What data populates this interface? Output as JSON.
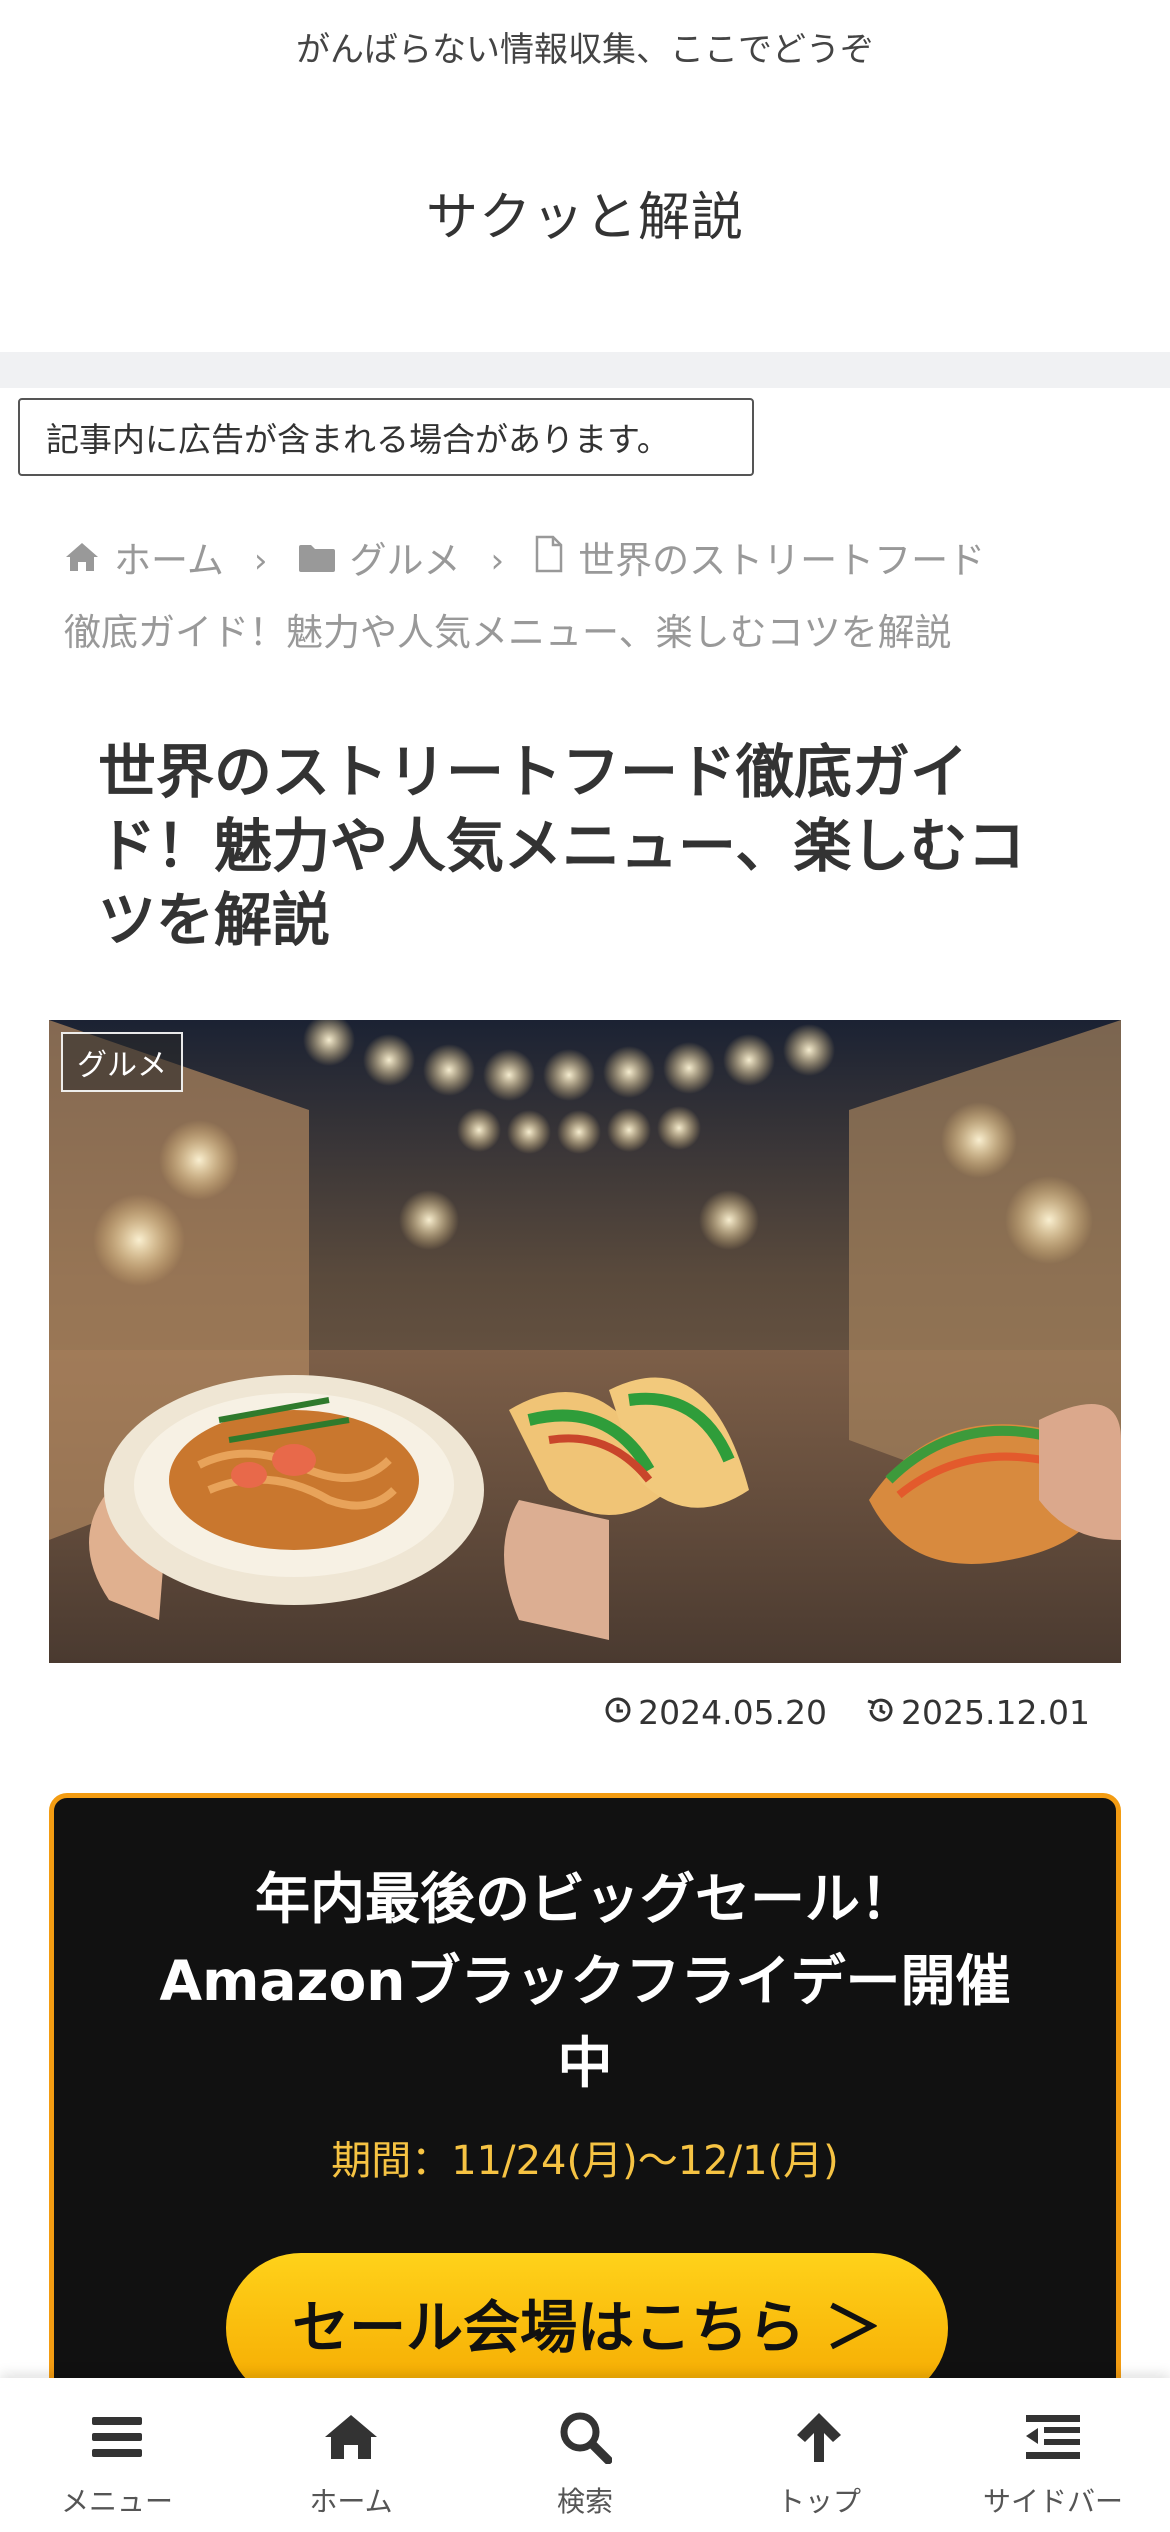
{
  "header": {
    "tagline": "がんばらない情報収集、ここでどうぞ",
    "site_title": "サクッと解説"
  },
  "ad_notice": "記事内に広告が含まれる場合があります。",
  "breadcrumb": {
    "home": "ホーム",
    "category": "グルメ",
    "current_line1": "世界のストリートフード",
    "current_line2": "徹底ガイド！魅力や人気メニュー、楽しむコツを解説",
    "icons": [
      "home-icon",
      "folder-icon",
      "file-icon"
    ]
  },
  "article": {
    "title": "世界のストリートフード徹底ガイド！魅力や人気メニュー、楽しむコツを解説",
    "category_badge": "グルメ",
    "published": "2024.05.20",
    "updated": "2025.12.01"
  },
  "promo": {
    "heading": "年内最後のビッグセール！Amazonブラックフライデー開催中",
    "period": "期間：11/24(月)〜12/1(月)",
    "cta": "セール会場はこちら ＞",
    "colors": {
      "background": "#111111",
      "border": "#f39c12",
      "period": "#f6c343",
      "cta": "#ffc107"
    }
  },
  "bottom_nav": {
    "items": [
      {
        "label": "メニュー",
        "icon": "hamburger-icon"
      },
      {
        "label": "ホーム",
        "icon": "home-icon"
      },
      {
        "label": "検索",
        "icon": "search-icon"
      },
      {
        "label": "トップ",
        "icon": "arrow-up-icon"
      },
      {
        "label": "サイドバー",
        "icon": "sidebar-icon"
      }
    ]
  }
}
